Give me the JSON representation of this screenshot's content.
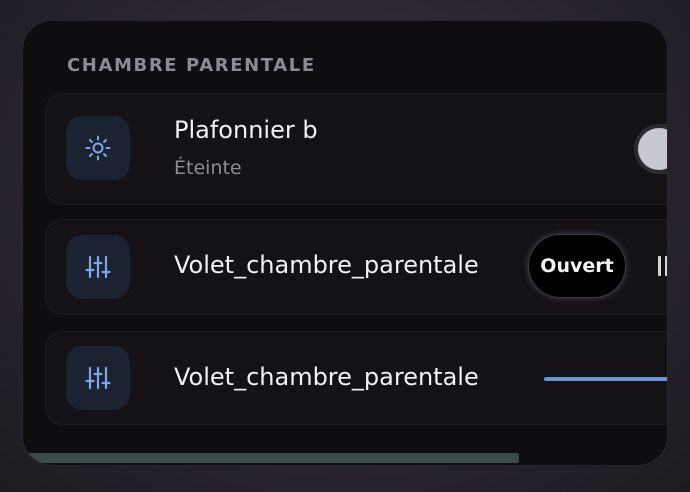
{
  "section": {
    "title": "CHAMBRE PARENTALE"
  },
  "entities": [
    {
      "name": "Plafonnier b",
      "state": "Éteinte",
      "icon": "sun-icon",
      "toggle_on": false
    },
    {
      "name": "Volet_chambre_parentale",
      "icon": "sliders-icon",
      "open_label": "Ouvert"
    },
    {
      "name": "Volet_chambre_parentale",
      "icon": "sliders-icon"
    }
  ],
  "colors": {
    "accent": "#7ea4ec",
    "card_bg": "#0f0d12",
    "row_bg": "#141217",
    "icon_tile_bg": "#1b2230"
  }
}
